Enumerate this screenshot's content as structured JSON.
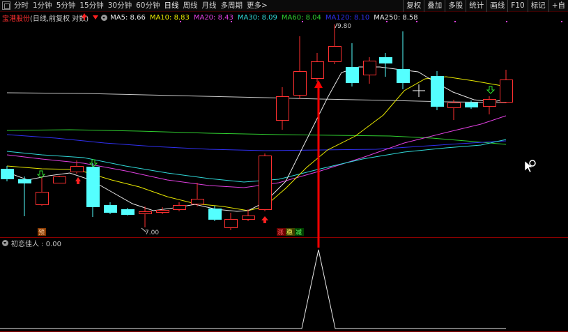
{
  "toolbar": {
    "tabs": [
      "分时",
      "1分钟",
      "5分钟",
      "15分钟",
      "30分钟",
      "60分钟",
      "日线",
      "周线",
      "月线",
      "多周期",
      "更多>"
    ],
    "active_tab": "日线",
    "buttons": [
      "复权",
      "叠加",
      "多股",
      "统计",
      "画线",
      "F10",
      "标记",
      "+自"
    ]
  },
  "legend": {
    "stock_name": "宝港股份",
    "desc": "(日线,前复权 对数)",
    "ma": [
      {
        "label": "MA5: 8.66",
        "color": "#e8e8e8"
      },
      {
        "label": "MA10: 8.83",
        "color": "#e8e800"
      },
      {
        "label": "MA20: 8.43",
        "color": "#e040e0"
      },
      {
        "label": "MA30: 8.09",
        "color": "#30d8d8"
      },
      {
        "label": "MA60: 8.04",
        "color": "#30d030"
      },
      {
        "label": "MA120: 8.10",
        "color": "#3030f0"
      },
      {
        "label": "MA250: 8.58",
        "color": "#e8e8e8"
      }
    ]
  },
  "annotations": {
    "high_label": "9.80",
    "low_label": "7.00",
    "marker_yu": "预",
    "marker_zhang": "涨",
    "marker_wen": "稳",
    "marker_jian": "减"
  },
  "indicator": {
    "label": "初恋佳人 : 0.00"
  },
  "colors": {
    "up": "#ff3030",
    "down": "#54ffff",
    "signal": "#ff0000",
    "ma5": "#e8e8e8",
    "ma10": "#e8e800",
    "ma20": "#e040e0",
    "ma30": "#30d8d8",
    "ma60": "#30d030",
    "ma120": "#3030f0",
    "ma250": "#c8c8c8"
  }
}
